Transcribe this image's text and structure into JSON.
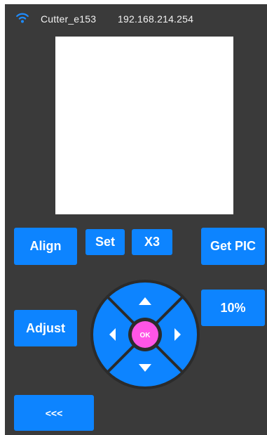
{
  "status": {
    "device_name": "Cutter_e153",
    "ip_address": "192.168.214.254"
  },
  "buttons": {
    "align": "Align",
    "set": "Set",
    "x3": "X3",
    "get_pic": "Get PIC",
    "percent": "10%",
    "adjust": "Adjust",
    "back": "<<<"
  },
  "dpad": {
    "ok": "OK"
  },
  "colors": {
    "panel_bg": "#3a3a3a",
    "accent": "#0d84ff",
    "ok_button": "#ff55e6",
    "dpad_ring": "#2b2b2b"
  }
}
